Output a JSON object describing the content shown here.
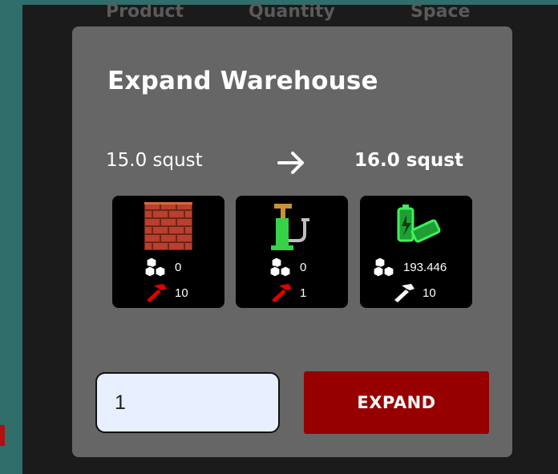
{
  "background": {
    "columns": [
      "Product",
      "Quantity",
      "Space"
    ]
  },
  "modal": {
    "title": "Expand Warehouse",
    "current_size": "15.0 squst",
    "new_size": "16.0 squst",
    "resources": [
      {
        "name": "bricks",
        "icon": "bricks-icon",
        "stock": "0",
        "required": "10",
        "status_color": "#e00000"
      },
      {
        "name": "pipes",
        "icon": "pipe-icon",
        "stock": "0",
        "required": "1",
        "status_color": "#e00000"
      },
      {
        "name": "batteries",
        "icon": "battery-icon",
        "stock": "193.446",
        "required": "10",
        "status_color": "#ffffff"
      }
    ],
    "quantity_value": "1",
    "expand_label": "EXPAND"
  },
  "colors": {
    "modal_bg": "#666666",
    "button": "#960000",
    "insufficient": "#e00000"
  }
}
